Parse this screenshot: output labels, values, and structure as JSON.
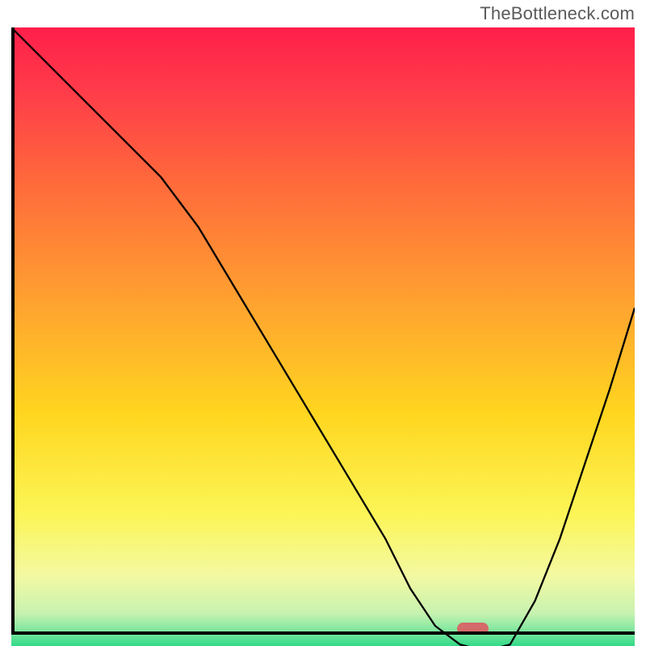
{
  "watermark": "TheBottleneck.com",
  "chart_data": {
    "type": "line",
    "title": "",
    "xlabel": "",
    "ylabel": "",
    "xlim": [
      0,
      100
    ],
    "ylim": [
      0,
      100
    ],
    "grid": false,
    "legend": false,
    "background": {
      "type": "vertical-gradient",
      "stops": [
        {
          "offset": 0.0,
          "color": "#ff1f4a"
        },
        {
          "offset": 0.1,
          "color": "#ff3b4a"
        },
        {
          "offset": 0.25,
          "color": "#ff6a3b"
        },
        {
          "offset": 0.45,
          "color": "#ffa52f"
        },
        {
          "offset": 0.62,
          "color": "#ffd61f"
        },
        {
          "offset": 0.78,
          "color": "#fcf556"
        },
        {
          "offset": 0.88,
          "color": "#f3f9a2"
        },
        {
          "offset": 0.94,
          "color": "#c7f2b0"
        },
        {
          "offset": 0.975,
          "color": "#6be49a"
        },
        {
          "offset": 1.0,
          "color": "#18d47e"
        }
      ]
    },
    "series": [
      {
        "name": "bottleneck-curve",
        "color": "#000000",
        "stroke_width": 2,
        "x": [
          0,
          6,
          12,
          18,
          24,
          30,
          36,
          42,
          48,
          54,
          60,
          64,
          68,
          72,
          76,
          80,
          84,
          88,
          92,
          96,
          100
        ],
        "y": [
          100,
          94,
          88,
          82,
          76,
          68,
          58,
          48,
          38,
          28,
          18,
          10,
          4,
          1,
          0,
          1,
          8,
          18,
          30,
          42,
          55
        ]
      }
    ],
    "marker": {
      "name": "ideal-point",
      "x": 74,
      "y": 1,
      "width_pct": 5,
      "height_pct": 2,
      "color": "#d46a6a"
    }
  }
}
